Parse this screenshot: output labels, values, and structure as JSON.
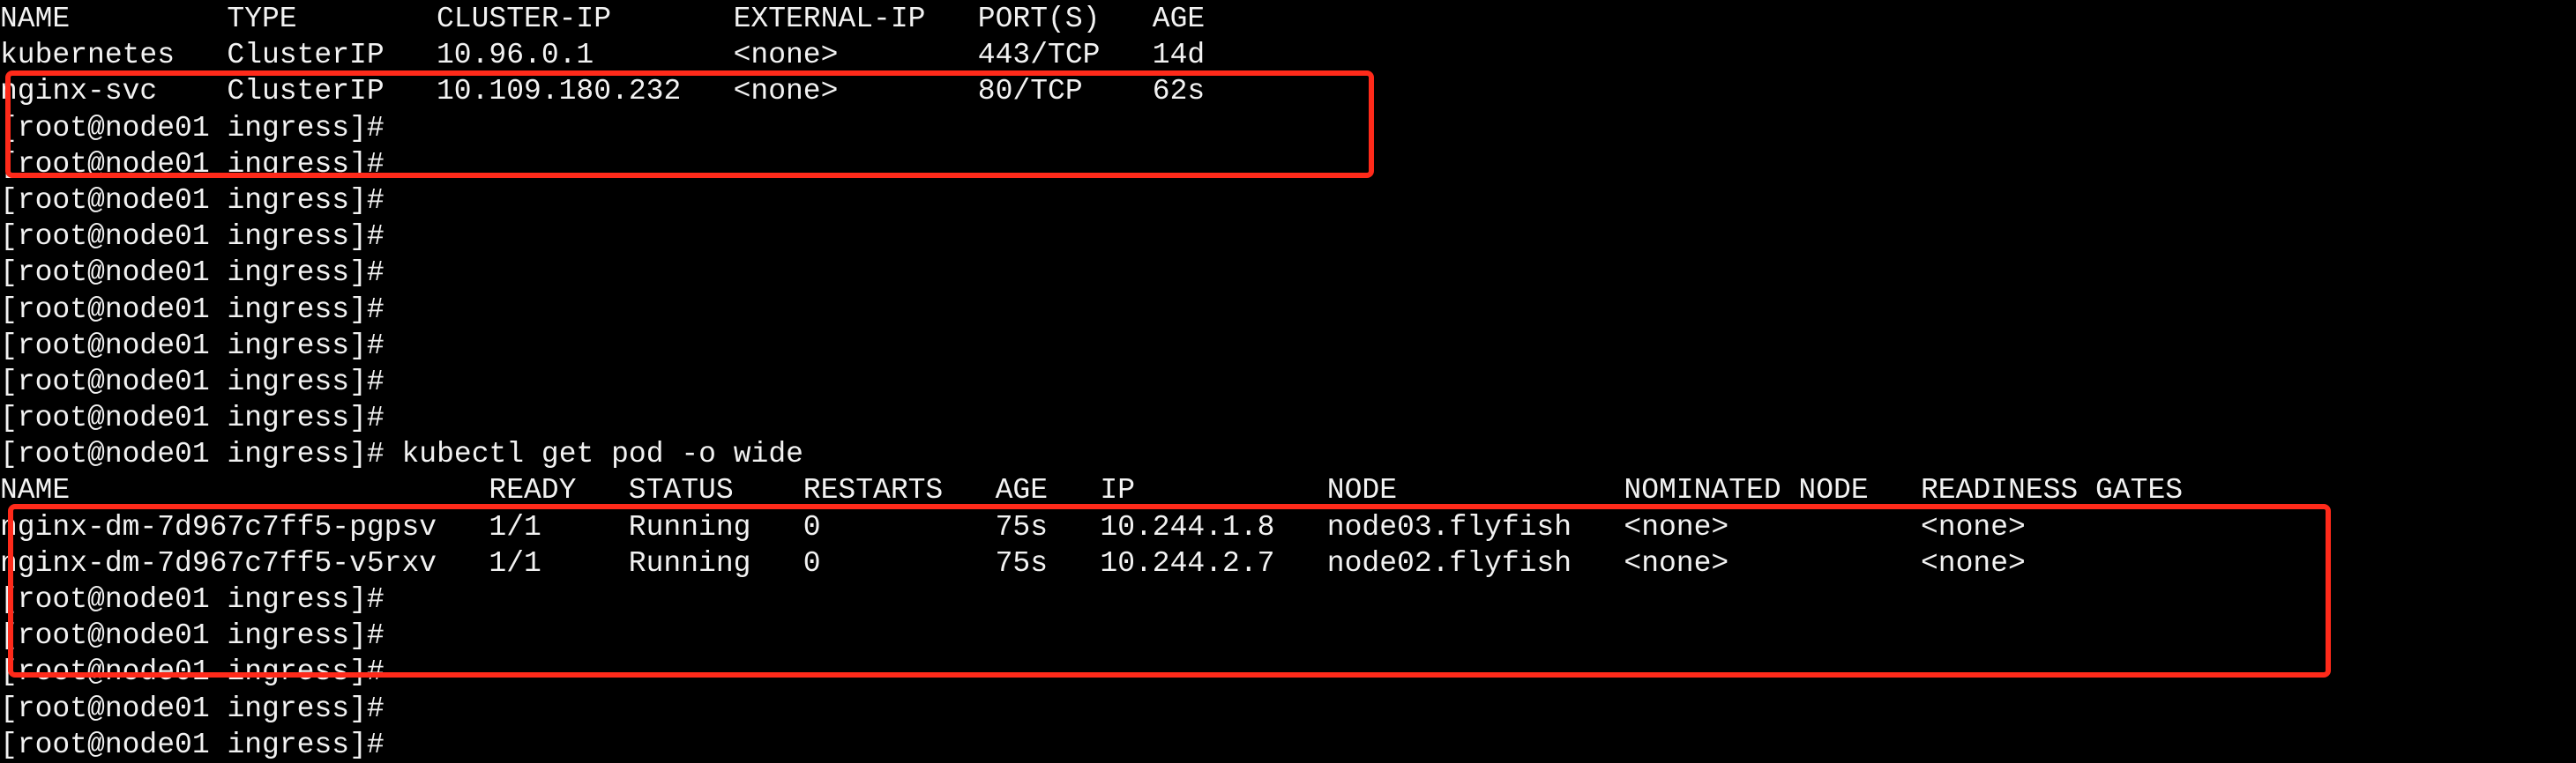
{
  "prompt": "[root@node01 ingress]#",
  "services": {
    "headers": [
      "NAME",
      "TYPE",
      "CLUSTER-IP",
      "EXTERNAL-IP",
      "PORT(S)",
      "AGE"
    ],
    "rows": [
      [
        "kubernetes",
        "ClusterIP",
        "10.96.0.1",
        "<none>",
        "443/TCP",
        "14d"
      ],
      [
        "nginx-svc",
        "ClusterIP",
        "10.109.180.232",
        "<none>",
        "80/TCP",
        "62s"
      ]
    ]
  },
  "command": "kubectl get pod -o wide",
  "pods": {
    "headers": [
      "NAME",
      "READY",
      "STATUS",
      "RESTARTS",
      "AGE",
      "IP",
      "NODE",
      "NOMINATED NODE",
      "READINESS GATES"
    ],
    "rows": [
      [
        "nginx-dm-7d967c7ff5-pgpsv",
        "1/1",
        "Running",
        "0",
        "75s",
        "10.244.1.8",
        "node03.flyfish",
        "<none>",
        "<none>"
      ],
      [
        "nginx-dm-7d967c7ff5-v5rxv",
        "1/1",
        "Running",
        "0",
        "75s",
        "10.244.2.7",
        "node02.flyfish",
        "<none>",
        "<none>"
      ]
    ]
  },
  "highlight_color": "#ff2a1a"
}
